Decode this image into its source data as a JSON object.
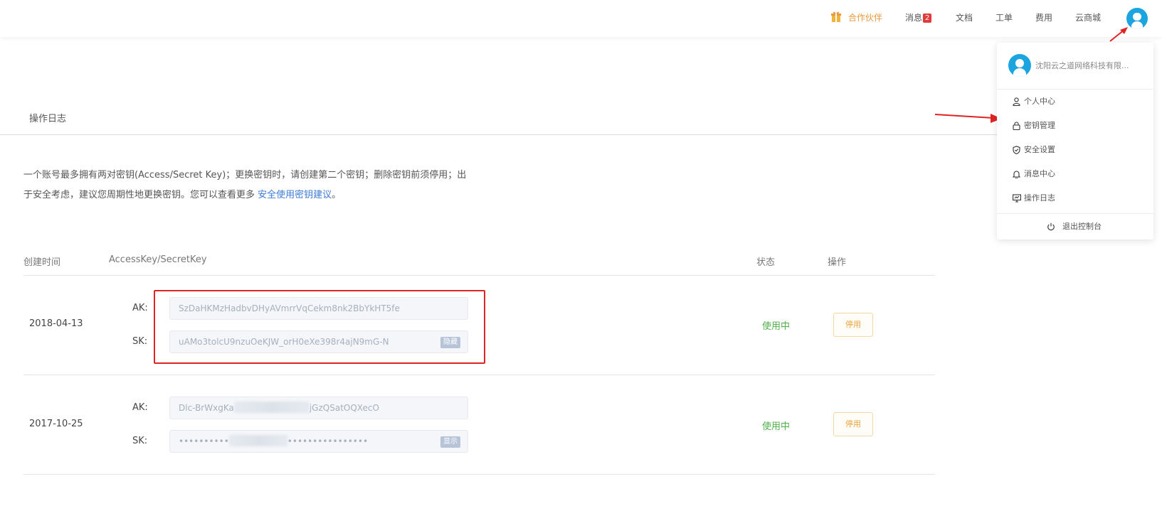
{
  "topbar": {
    "partner": "合作伙伴",
    "messages": "消息",
    "messages_count": "2",
    "docs": "文档",
    "tickets": "工单",
    "billing": "费用",
    "marketplace": "云商城"
  },
  "tabs": {
    "active": "操作日志"
  },
  "notice": {
    "text": "一个账号最多拥有两对密钥(Access/Secret Key)；更换密钥时，请创建第二个密钥；删除密钥前须停用；出于安全考虑，建议您周期性地更换密钥。您可以查看更多 ",
    "link": "安全使用密钥建议",
    "end": "。"
  },
  "table": {
    "headers": {
      "created": "创建时间",
      "keys": "AccessKey/SecretKey",
      "status": "状态",
      "action": "操作"
    },
    "rows": [
      {
        "date": "2018-04-13",
        "ak_label": "AK:",
        "ak": "SzDaHKMzHadbvDHyAVmrrVqCekm8nk2BbYkHT5fe",
        "sk_label": "SK:",
        "sk": "uAMo3tolcU9nzuOeKJW_orH0eXe398r4ajN9mG-N",
        "sk_toggle": "隐藏",
        "status": "使用中",
        "action": "停用"
      },
      {
        "date": "2017-10-25",
        "ak_label": "AK:",
        "ak_start": "Dlc-BrWxgKa",
        "ak_end": "jGzQSatOQXecO",
        "sk_label": "SK:",
        "sk_start": "••••••••••",
        "sk_end": "••••••••••••••••",
        "sk_toggle": "显示",
        "status": "使用中",
        "action": "停用"
      }
    ]
  },
  "dropdown": {
    "company": "沈阳云之道网络科技有限...",
    "items": [
      {
        "label": "个人中心",
        "icon": "user-icon"
      },
      {
        "label": "密钥管理",
        "icon": "lock-icon"
      },
      {
        "label": "安全设置",
        "icon": "shield-icon"
      },
      {
        "label": "消息中心",
        "icon": "bell-icon"
      },
      {
        "label": "操作日志",
        "icon": "monitor-icon"
      }
    ],
    "logout": "退出控制台"
  },
  "colors": {
    "accent_link": "#3d7ad6",
    "status_active": "#4fb04a",
    "partner": "#e89a3c",
    "annotation_red": "#e02424",
    "avatar": "#1aa4e0"
  }
}
